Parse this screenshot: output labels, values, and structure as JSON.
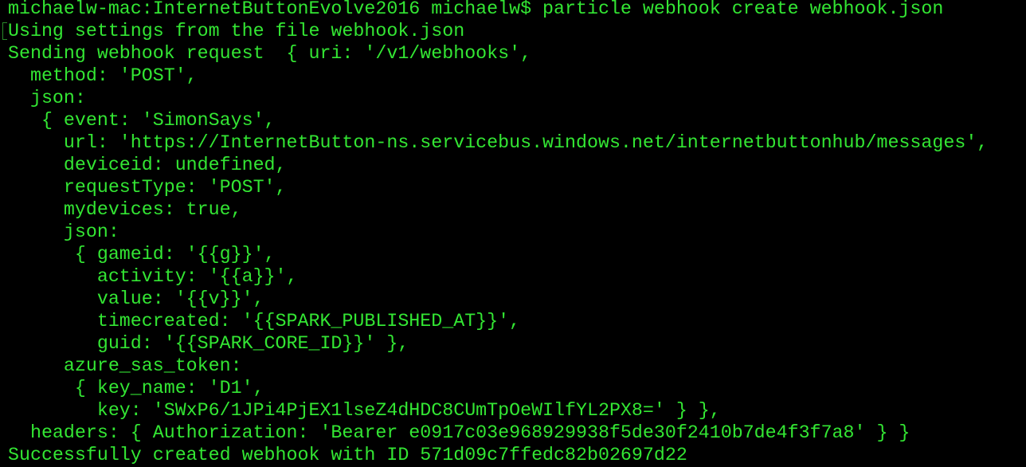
{
  "colors": {
    "background": "#000000",
    "text": "#33e633"
  },
  "terminal": {
    "lines": [
      "michaelw-mac:InternetButtonEvolve2016 michaelw$ particle webhook create webhook.json",
      "Using settings from the file webhook.json",
      "Sending webhook request  { uri: '/v1/webhooks',",
      "  method: 'POST',",
      "  json:",
      "   { event: 'SimonSays',",
      "     url: 'https://InternetButton-ns.servicebus.windows.net/internetbuttonhub/messages',",
      "     deviceid: undefined,",
      "     requestType: 'POST',",
      "     mydevices: true,",
      "     json:",
      "      { gameid: '{{g}}',",
      "        activity: '{{a}}',",
      "        value: '{{v}}',",
      "        timecreated: '{{SPARK_PUBLISHED_AT}}',",
      "        guid: '{{SPARK_CORE_ID}}' },",
      "     azure_sas_token:",
      "      { key_name: 'D1',",
      "        key: 'SWxP6/1JPi4PjEX1lseZ4dHDC8CUmTpOeWIlfYL2PX8=' } },",
      "  headers: { Authorization: 'Bearer e0917c03e968929938f5de30f2410b7de4f3f7a8' } }",
      "Successfully created webhook with ID 571d09c7ffedc82b02697d22"
    ]
  }
}
